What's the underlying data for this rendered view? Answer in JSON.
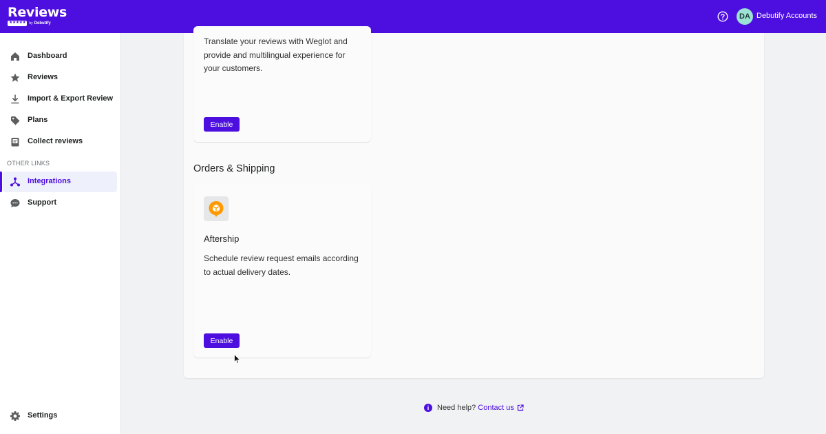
{
  "header": {
    "logo_text": "Reviews",
    "logo_by": "by",
    "logo_brand": "Debutify",
    "logo_stars": "★★★★★",
    "avatar_initials": "DA",
    "account_name": "Debutify Accounts",
    "help_icon": "question-circle-icon",
    "background": "#4d0ee0"
  },
  "sidebar": {
    "items": [
      {
        "label": "Dashboard",
        "icon": "home-icon"
      },
      {
        "label": "Reviews",
        "icon": "star-icon"
      },
      {
        "label": "Import & Export Review",
        "icon": "download-icon"
      },
      {
        "label": "Plans",
        "icon": "tag-icon"
      },
      {
        "label": "Collect reviews",
        "icon": "clipboard-icon"
      }
    ],
    "section_label": "OTHER LINKS",
    "other_items": [
      {
        "label": "Integrations",
        "icon": "network-icon",
        "active": true
      },
      {
        "label": "Support",
        "icon": "chat-bubble-icon"
      }
    ],
    "settings": {
      "label": "Settings",
      "icon": "gear-icon"
    }
  },
  "main": {
    "weglot_card": {
      "description": "Translate your reviews with Weglot and provide and multilingual experience for your customers.",
      "button": "Enable"
    },
    "orders_section": {
      "title": "Orders & Shipping",
      "card": {
        "icon": "aftership-icon",
        "title": "Aftership",
        "description": "Schedule review request emails according to actual delivery dates.",
        "button": "Enable"
      }
    }
  },
  "footer": {
    "help_text": "Need help?",
    "link_text": "Contact us",
    "info_icon": "info-circle-icon",
    "external_icon": "external-link-icon"
  },
  "colors": {
    "accent": "#4d0ee0",
    "active_bg": "#eef0fb",
    "page_bg": "#f1f2f4"
  }
}
